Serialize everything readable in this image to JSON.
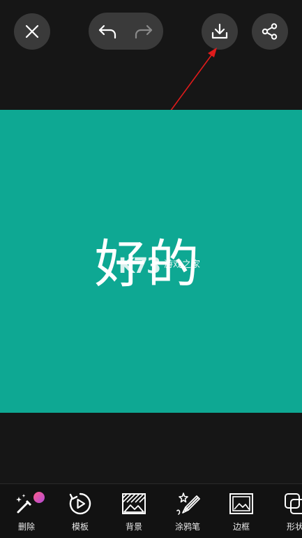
{
  "canvas": {
    "text": "好的",
    "background": "#0ea893"
  },
  "watermark": {
    "logo": "K73",
    "text": "游戏之家"
  },
  "top_bar": {
    "icons": [
      "close-icon",
      "undo-icon",
      "redo-icon",
      "download-icon",
      "share-icon"
    ]
  },
  "toolbar": {
    "items": [
      {
        "label": "删除",
        "icon": "magic-eraser-icon"
      },
      {
        "label": "模板",
        "icon": "play-refresh-icon"
      },
      {
        "label": "背景",
        "icon": "background-icon"
      },
      {
        "label": "涂鸦笔",
        "icon": "brush-icon"
      },
      {
        "label": "边框",
        "icon": "frame-icon"
      },
      {
        "label": "形状",
        "icon": "shape-icon"
      }
    ]
  },
  "colors": {
    "app_background": "#161616",
    "button_background": "#3a3a3a",
    "annotation_arrow": "#e01b1b"
  }
}
